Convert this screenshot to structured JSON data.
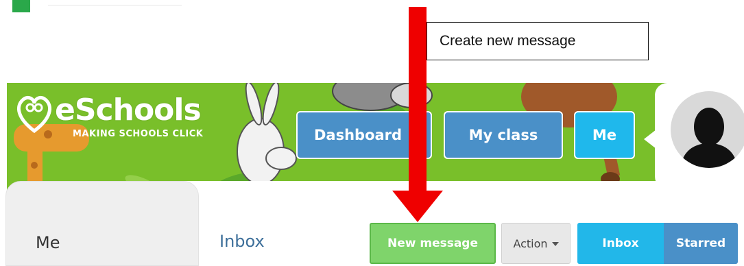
{
  "annotation": {
    "callout_text": "Create new message",
    "arrow_color": "#ef0000"
  },
  "header": {
    "logo_text": "eSchools",
    "logo_tagline": "MAKING SCHOOLS CLICK",
    "banner_color": "#79bf2a",
    "nav": {
      "dashboard_label": "Dashboard",
      "myclass_label": "My class",
      "me_label": "Me"
    },
    "avatar_icon": "user-silhouette-icon"
  },
  "content": {
    "tab_label": "Me",
    "page_title": "Inbox",
    "toolbar": {
      "new_message_label": "New message",
      "action_label": "Action",
      "inbox_label": "Inbox",
      "starred_label": "Starred"
    },
    "colors": {
      "new_message": "#7fd46b",
      "inbox": "#22b7e9",
      "starred": "#4a90c8"
    }
  }
}
